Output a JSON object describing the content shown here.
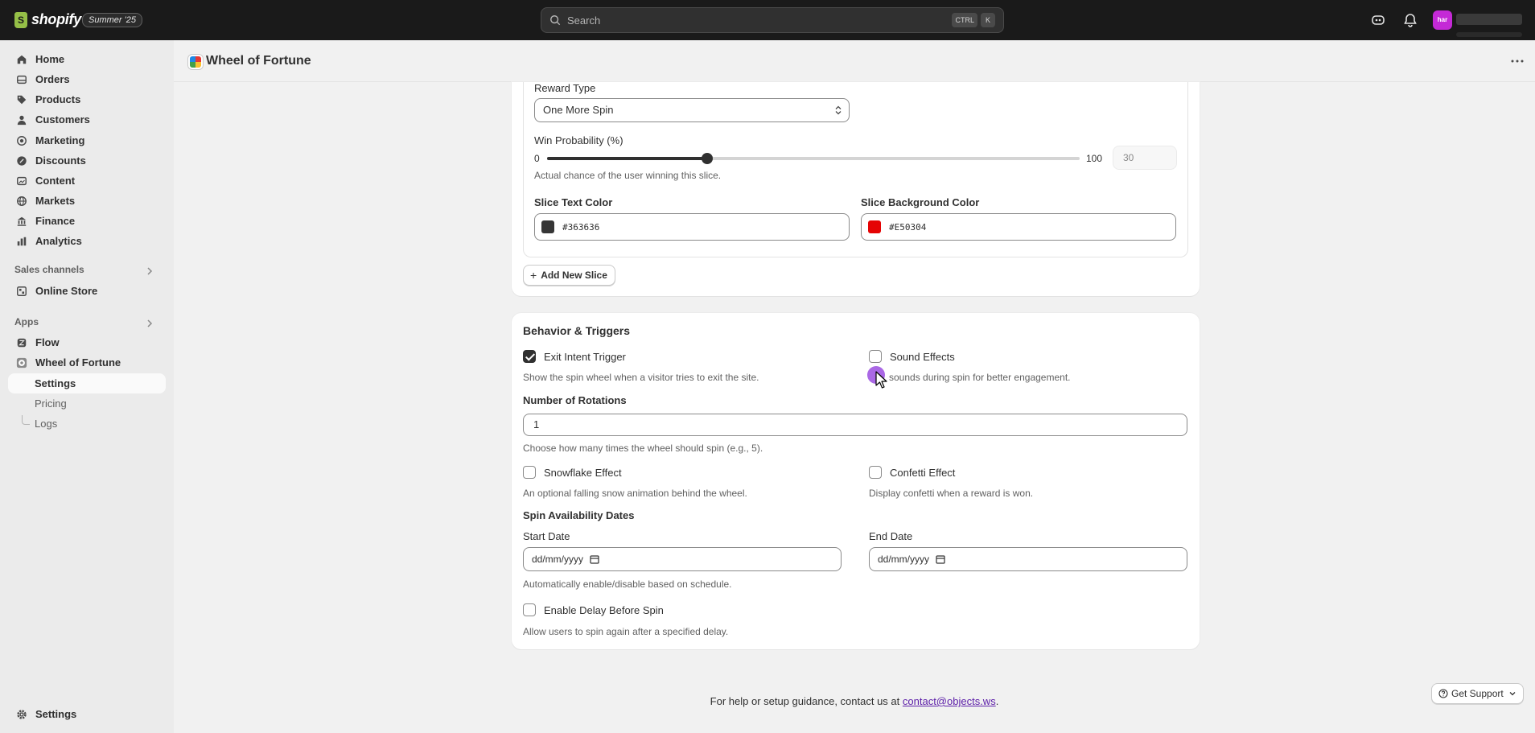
{
  "topbar": {
    "brand": "shopify",
    "edition_badge": "Summer '25",
    "search_placeholder": "Search",
    "shortcut_keys": [
      "CTRL",
      "K"
    ],
    "avatar_initials": "har"
  },
  "sidebar": {
    "items": [
      {
        "label": "Home",
        "icon": "home-icon"
      },
      {
        "label": "Orders",
        "icon": "orders-icon"
      },
      {
        "label": "Products",
        "icon": "products-icon"
      },
      {
        "label": "Customers",
        "icon": "customers-icon"
      },
      {
        "label": "Marketing",
        "icon": "marketing-icon"
      },
      {
        "label": "Discounts",
        "icon": "discounts-icon"
      },
      {
        "label": "Content",
        "icon": "content-icon"
      },
      {
        "label": "Markets",
        "icon": "markets-icon"
      },
      {
        "label": "Finance",
        "icon": "finance-icon"
      },
      {
        "label": "Analytics",
        "icon": "analytics-icon"
      }
    ],
    "sales_channels_label": "Sales channels",
    "online_store_label": "Online Store",
    "apps_label": "Apps",
    "flow_label": "Flow",
    "app_name": "Wheel of Fortune",
    "app_subitems": [
      "Settings",
      "Pricing",
      "Logs"
    ],
    "settings_label": "Settings"
  },
  "page": {
    "title": "Wheel of Fortune"
  },
  "slice": {
    "reward_type_label": "Reward Type",
    "reward_type_value": "One More Spin",
    "win_probability_label": "Win Probability (%)",
    "slider_min": "0",
    "slider_max": "100",
    "win_probability_value": "30",
    "win_probability_fraction": 0.3,
    "win_probability_help": "Actual chance of the user winning this slice.",
    "text_color_label": "Slice Text Color",
    "text_color_value": "#363636",
    "bg_color_label": "Slice Background Color",
    "bg_color_value": "#E50304",
    "add_slice_label": "Add New Slice"
  },
  "behavior": {
    "title": "Behavior & Triggers",
    "exit_intent_label": "Exit Intent Trigger",
    "exit_intent_checked": true,
    "exit_intent_help": "Show the spin wheel when a visitor tries to exit the site.",
    "sound_label": "Sound Effects",
    "sound_checked": false,
    "sound_help": "sounds during spin for better engagement.",
    "rotations_label": "Number of Rotations",
    "rotations_value": "1",
    "rotations_help": "Choose how many times the wheel should spin (e.g., 5).",
    "snowflake_label": "Snowflake Effect",
    "snowflake_checked": false,
    "snowflake_help": "An optional falling snow animation behind the wheel.",
    "confetti_label": "Confetti Effect",
    "confetti_checked": false,
    "confetti_help": "Display confetti when a reward is won.",
    "dates_title": "Spin Availability Dates",
    "start_date_label": "Start Date",
    "start_date_value": "dd/mm/yyyy",
    "end_date_label": "End Date",
    "end_date_value": "dd/mm/yyyy",
    "dates_help": "Automatically enable/disable based on schedule.",
    "delay_label": "Enable Delay Before Spin",
    "delay_checked": false,
    "delay_help": "Allow users to spin again after a specified delay."
  },
  "footer": {
    "text": "For help or setup guidance, contact us at",
    "email": "contact@objects.ws",
    "period": ".",
    "support_label": "Get Support"
  },
  "colors": {
    "topbar_bg": "#1a1a1a",
    "accent_link": "#5c1ea8",
    "avatar_bg": "#c429d6"
  }
}
